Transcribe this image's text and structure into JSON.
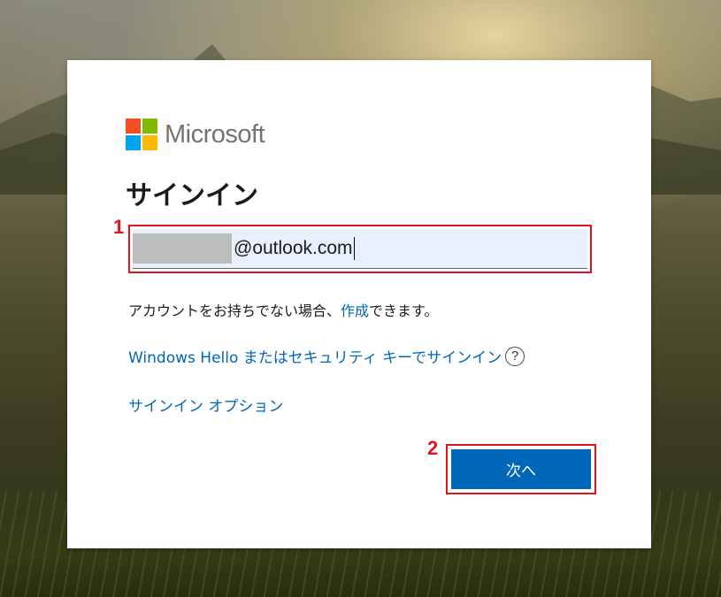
{
  "brand": {
    "name": "Microsoft",
    "colors": {
      "red": "#f25022",
      "green": "#7fba00",
      "blue": "#00a4ef",
      "yellow": "#ffb900"
    }
  },
  "signin": {
    "title": "サインイン",
    "email_value": "@outlook.com",
    "no_account_prefix": "アカウントをお持ちでない場合、",
    "create_link": "作成",
    "no_account_suffix": "できます。",
    "windows_hello_link": "Windows Hello またはセキュリティ キーでサインイン",
    "help_icon": "?",
    "options_link": "サインイン オプション",
    "next_button": "次へ"
  },
  "annotations": {
    "step1": "1",
    "step2": "2",
    "highlight_color": "#e0141c"
  },
  "accent_color": "#0067b8"
}
